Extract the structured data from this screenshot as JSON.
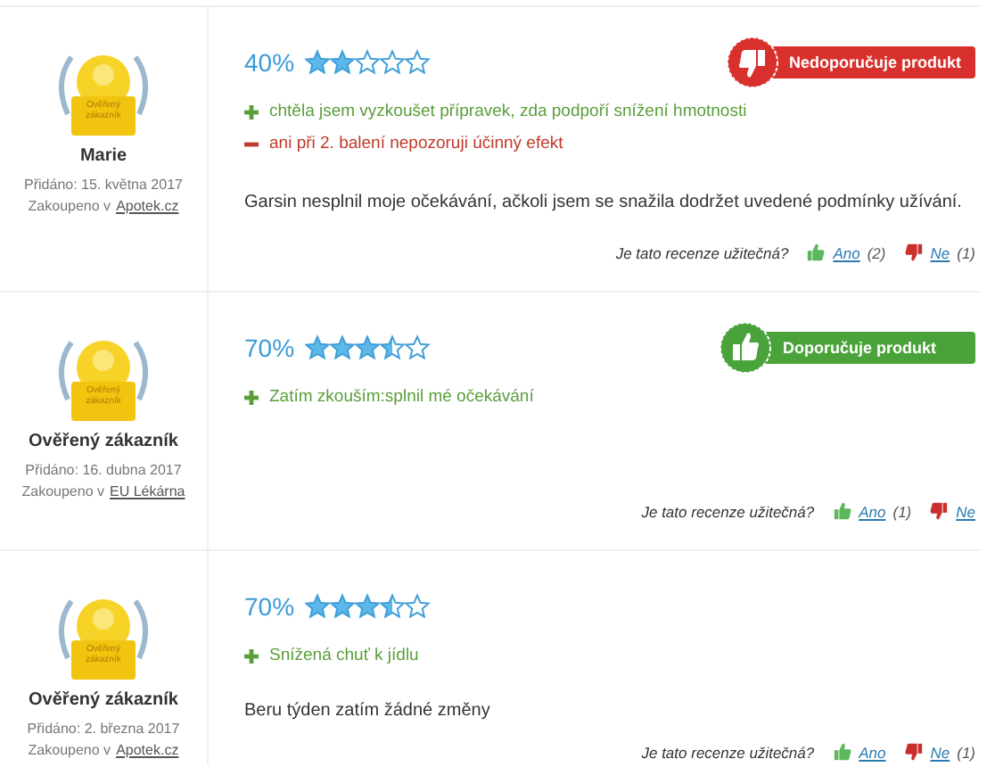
{
  "reviews": [
    {
      "author": "Marie",
      "badge_label": "Ověřený zákazník",
      "added": "Přidáno: 15. května 2017",
      "purchased_prefix": "Zakoupeno v",
      "shop": "Apotek.cz",
      "percent": "40%",
      "stars": 2,
      "recommendation": {
        "kind": "negative",
        "label": "Nedoporučuje produkt"
      },
      "points": [
        {
          "kind": "pro",
          "text": "chtěla jsem vyzkoušet přípravek, zda podpoří snížení hmotnosti"
        },
        {
          "kind": "con",
          "text": "ani při 2. balení nepozoruji účinný efekt"
        }
      ],
      "text": "Garsin nesplnil moje očekávání, ačkoli jsem se snažila dodržet uvedené podmínky užívání.",
      "helpful": {
        "question": "Je tato recenze užitečná?",
        "yes": "Ano",
        "yes_count": "(2)",
        "no": "Ne",
        "no_count": "(1)"
      }
    },
    {
      "author": "Ověřený zákazník",
      "badge_label": "Ověřený zákazník",
      "added": "Přidáno: 16. dubna 2017",
      "purchased_prefix": "Zakoupeno v",
      "shop": "EU Lékárna",
      "percent": "70%",
      "stars": 3.5,
      "recommendation": {
        "kind": "positive",
        "label": "Doporučuje produkt"
      },
      "points": [
        {
          "kind": "pro",
          "text": "Zatím zkouším:splnil mé očekávání"
        }
      ],
      "helpful": {
        "question": "Je tato recenze užitečná?",
        "yes": "Ano",
        "yes_count": "(1)",
        "no": "Ne"
      }
    },
    {
      "author": "Ověřený zákazník",
      "badge_label": "Ověřený zákazník",
      "added": "Přidáno: 2. března 2017",
      "purchased_prefix": "Zakoupeno v",
      "shop": "Apotek.cz",
      "percent": "70%",
      "stars": 3.5,
      "points": [
        {
          "kind": "pro",
          "text": "Snížená chuť k jídlu"
        }
      ],
      "text": "Beru týden zatím žádné změny",
      "helpful": {
        "question": "Je tato recenze užitečná?",
        "yes": "Ano",
        "no": "Ne",
        "no_count": "(1)"
      }
    }
  ]
}
